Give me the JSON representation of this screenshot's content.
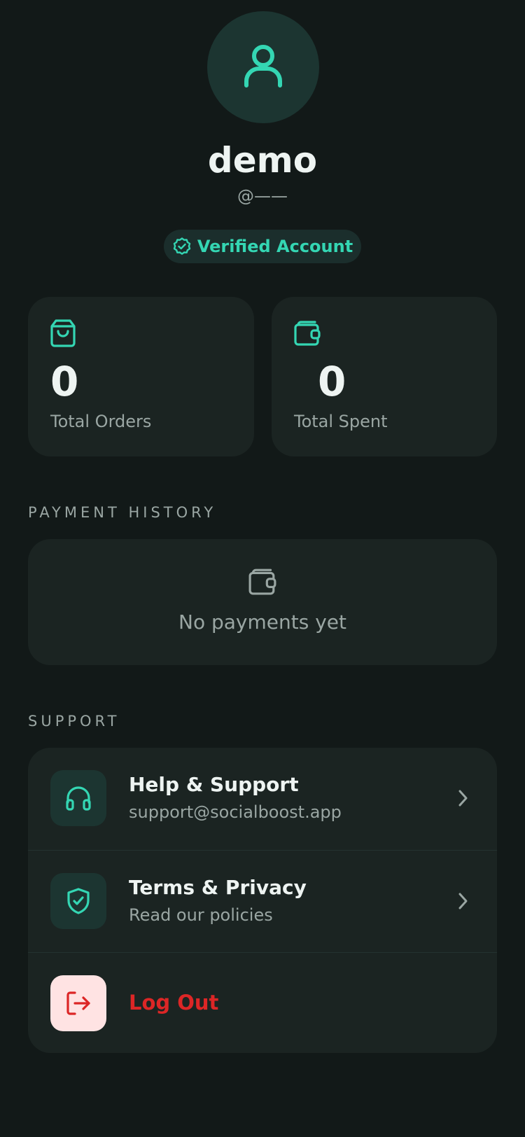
{
  "profile": {
    "name": "demo",
    "handle": "@——",
    "badge": "Verified Account"
  },
  "stats": [
    {
      "value": "0",
      "label": "Total Orders",
      "icon": "shopping-bag-icon"
    },
    {
      "value": "0",
      "label": "Total Spent",
      "icon": "wallet-icon"
    }
  ],
  "payments": {
    "title": "PAYMENT HISTORY",
    "empty_text": "No payments yet",
    "icon": "wallet-icon"
  },
  "support": {
    "title": "SUPPORT",
    "items": [
      {
        "title": "Help & Support",
        "subtitle": "support@socialboost.app",
        "icon": "headphones-icon"
      },
      {
        "title": "Terms & Privacy",
        "subtitle": "Read our policies",
        "icon": "shield-check-icon"
      },
      {
        "title": "Log Out",
        "icon": "logout-icon"
      }
    ]
  },
  "colors": {
    "background": "#121918",
    "card": "#1b2422",
    "accent": "#34d6b3",
    "danger": "#dc2626"
  }
}
